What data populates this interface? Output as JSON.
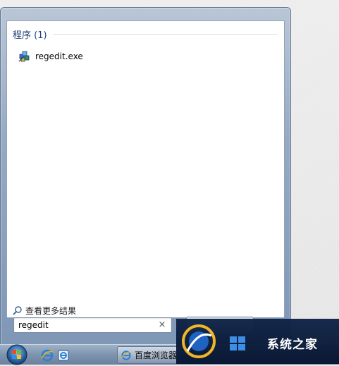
{
  "start_menu": {
    "group_title": "程序 (1)",
    "results": [
      {
        "label": "regedit.exe",
        "icon": "regedit-icon"
      }
    ],
    "see_more_label": "查看更多结果"
  },
  "search": {
    "value": "regedit",
    "clear_icon": "×"
  },
  "taskbar": {
    "browser_item_label": "百度浏览器"
  },
  "watermark": {
    "text": "系统之家"
  },
  "colors": {
    "header_text": "#1e3f7a",
    "menu_frame": "#95a9c2",
    "taskbar": "#7d93ae"
  }
}
